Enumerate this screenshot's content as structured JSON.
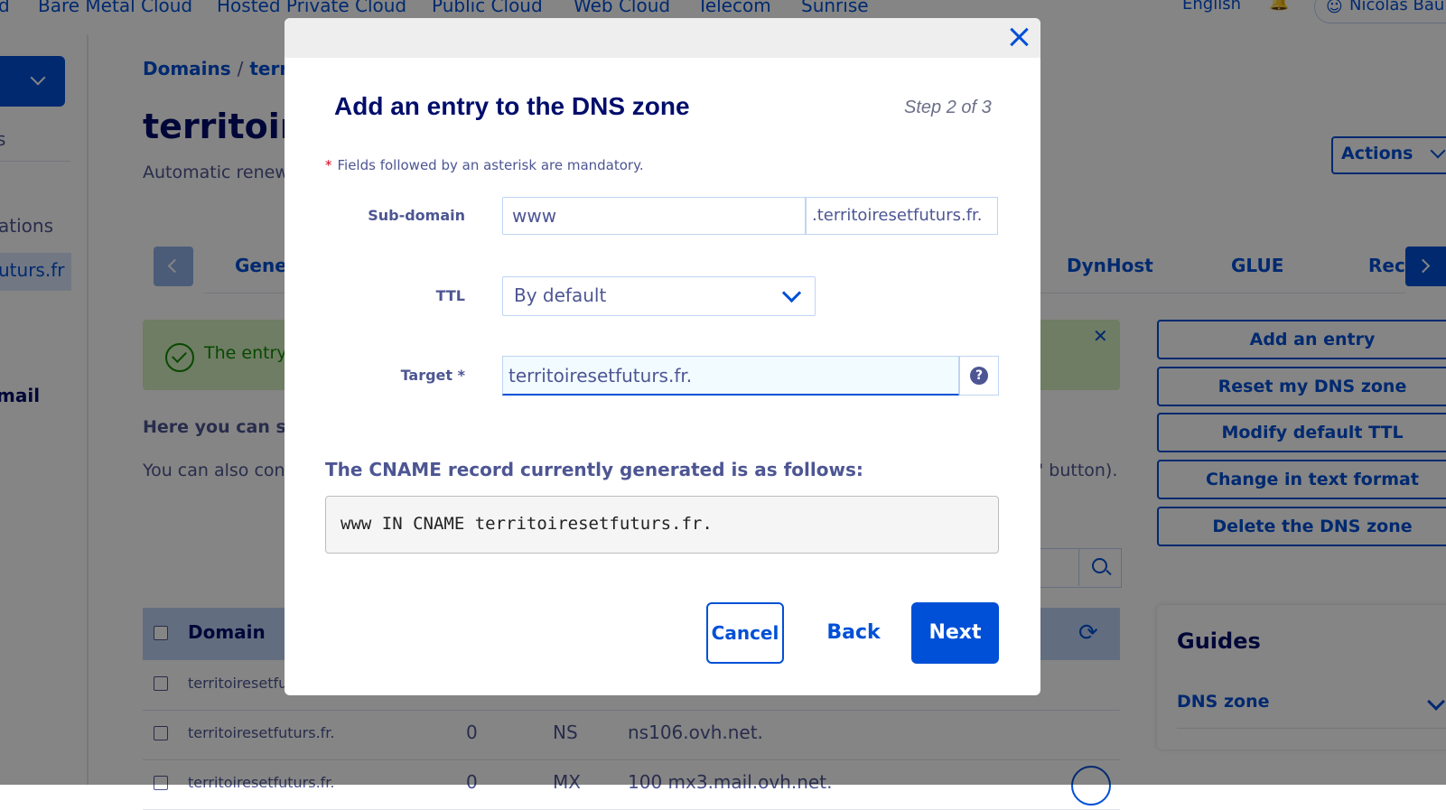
{
  "topnav": {
    "items": [
      "d",
      "Bare Metal Cloud",
      "Hosted Private Cloud",
      "Public Cloud",
      "Web Cloud",
      "Telecom",
      "Sunrise"
    ],
    "language": "English",
    "user": "Nicolas Bault"
  },
  "sidebar": {
    "text_s": "s",
    "text_ations": "ations",
    "active_item": "uturs.fr",
    "text_mail": "mail"
  },
  "page": {
    "breadcrumb_root": "Domains",
    "breadcrumb_sep": "/",
    "breadcrumb_current": "territ",
    "title": "territoire",
    "renew": "Automatic renew",
    "actions_label": "Actions",
    "tabs": [
      "Gener",
      "DynHost",
      "GLUE",
      "Rec"
    ],
    "banner_text": "The entry",
    "here_text": "Here you can se",
    "also_text": "You can also con",
    "button_text": "' button)."
  },
  "table": {
    "header_domain": "Domain",
    "rows": [
      {
        "domain": "territoiresetfut",
        "ttl": "",
        "type": "",
        "target": ""
      },
      {
        "domain": "territoiresetfuturs.fr.",
        "ttl": "0",
        "type": "NS",
        "target": "ns106.ovh.net."
      },
      {
        "domain": "territoiresetfuturs.fr.",
        "ttl": "0",
        "type": "MX",
        "target": "100 mx3.mail.ovh.net."
      }
    ]
  },
  "side_actions": [
    "Add an entry",
    "Reset my DNS zone",
    "Modify default TTL",
    "Change in text format",
    "Delete the DNS zone"
  ],
  "guides": {
    "title": "Guides",
    "item": "DNS zone"
  },
  "modal": {
    "title": "Add an entry to the DNS zone",
    "step": "Step 2 of 3",
    "mandatory_asterisk": "*",
    "mandatory_note": "Fields followed by an asterisk are mandatory.",
    "subdomain_label": "Sub-domain",
    "subdomain_value": "www",
    "subdomain_suffix": ".territoiresetfuturs.fr.",
    "ttl_label": "TTL",
    "ttl_value": "By default",
    "target_label": "Target *",
    "target_value": "territoiresetfuturs.fr.",
    "help_glyph": "?",
    "generated_heading": "The CNAME record currently generated is as follows:",
    "generated_record": "www IN CNAME territoiresetfuturs.fr.",
    "cancel_label": "Cancel",
    "back_label": "Back",
    "next_label": "Next"
  },
  "colors": {
    "brand": "#0050d7",
    "title": "#000d6b",
    "text": "#4d5693",
    "success_bg": "#d4f0c0"
  }
}
